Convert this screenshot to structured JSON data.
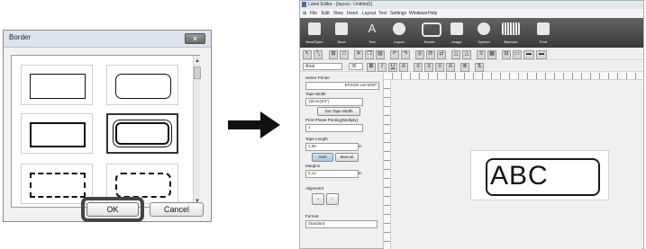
{
  "dialog": {
    "title": "Border",
    "close_icon": "close-icon",
    "ok_label": "OK",
    "cancel_label": "Cancel",
    "border_options": [
      "thin-rectangle",
      "thin-rounded",
      "thick-rectangle",
      "double-rounded",
      "dashed-rectangle",
      "dashed-rounded"
    ]
  },
  "arrow": {
    "icon": "right-arrow-icon",
    "color": "#111111"
  },
  "app": {
    "title": "Label Editor - [layout - Untitled1]",
    "menu": [
      "File",
      "Edit",
      "View",
      "Insert",
      "Layout",
      "Text",
      "Settings",
      "Windows",
      "Help"
    ],
    "ribbon": [
      "New/Open",
      "Save",
      "Text",
      "Import",
      "Border",
      "Image",
      "Symbol",
      "Barcode",
      "Print"
    ],
    "font": "Arial",
    "font_size": "36",
    "panel": {
      "select_printer_label": "Select Printer",
      "printer_value": "EPSON LW-600P",
      "tape_width_label": "Tape Width",
      "tape_width_value": "18mm(3/4\")",
      "get_tape_width": "Get Tape Width",
      "print_paste_label": "Print+Paste Printing(Multiply)",
      "print_paste_value": "1",
      "tape_length_label": "Tape Length",
      "tape_length_value": "1.96",
      "unit_in": "in",
      "auto_label": "Auto",
      "manual_label": "Manual",
      "margins_label": "Margins",
      "margins_value": "0.12",
      "alignment_label": "Alignment",
      "format_label": "Format",
      "format_value": "Standard"
    },
    "label_text": "ABC"
  }
}
